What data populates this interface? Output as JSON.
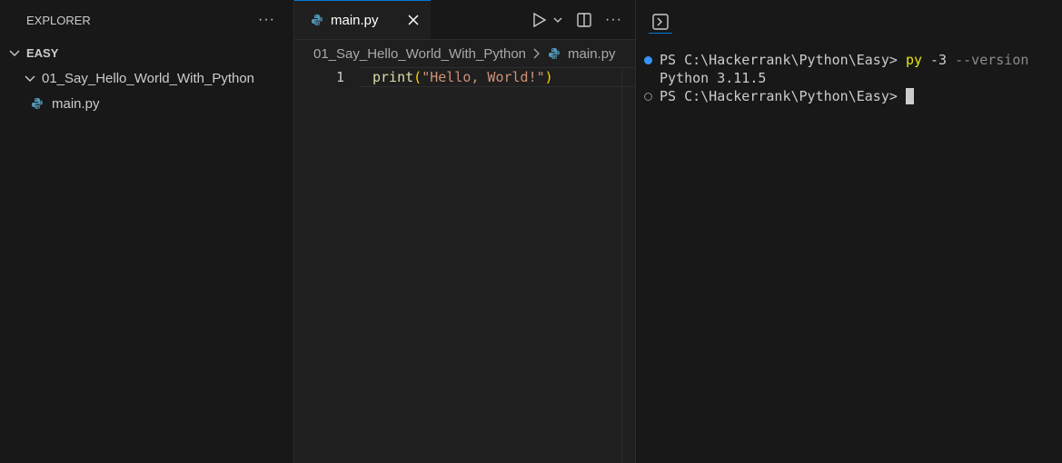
{
  "sidebar": {
    "title": "EXPLORER",
    "more_icon": "ellipsis-icon",
    "root": {
      "label": "EASY"
    },
    "folder": {
      "label": "01_Say_Hello_World_With_Python"
    },
    "file": {
      "label": "main.py"
    }
  },
  "editor": {
    "tab": {
      "label": "main.py"
    },
    "breadcrumb": {
      "folder": "01_Say_Hello_World_With_Python",
      "file": "main.py"
    },
    "lines": [
      {
        "number": "1",
        "fn": "print",
        "open": "(",
        "string": "\"Hello, World!\"",
        "close": ")"
      }
    ]
  },
  "terminal": {
    "lines": [
      {
        "prompt": "PS C:\\Hackerrank\\Python\\Easy> ",
        "cmd": "py",
        "arg": " -3 ",
        "flag": "--version"
      },
      {
        "output": "Python 3.11.5"
      },
      {
        "prompt": "PS C:\\Hackerrank\\Python\\Easy> "
      }
    ]
  },
  "colors": {
    "accent": "#0078d4",
    "python_icon": "#519aba",
    "command": "#e5e510",
    "string": "#ce9178",
    "function": "#dcdcaa"
  }
}
